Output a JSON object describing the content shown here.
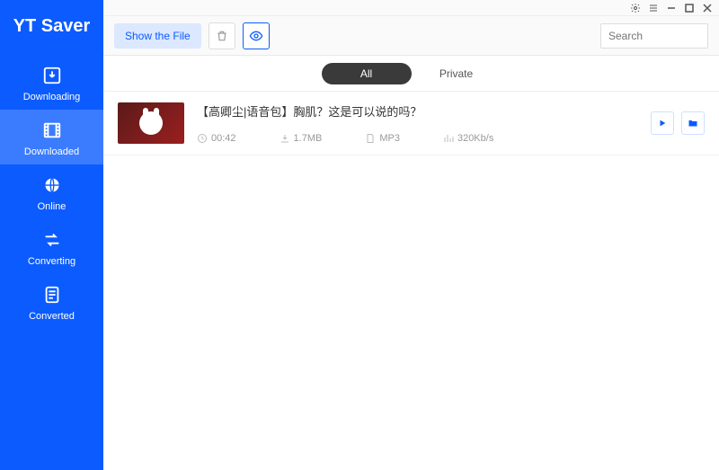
{
  "app": {
    "title": "YT Saver"
  },
  "sidebar": {
    "items": [
      {
        "label": "Downloading"
      },
      {
        "label": "Downloaded"
      },
      {
        "label": "Online"
      },
      {
        "label": "Converting"
      },
      {
        "label": "Converted"
      }
    ],
    "activeIndex": 1
  },
  "toolbar": {
    "show_file_label": "Show the File",
    "search_placeholder": "Search"
  },
  "tabs": {
    "items": [
      "All",
      "Private"
    ],
    "activeIndex": 0
  },
  "rows": [
    {
      "title": "【高卿尘|语音包】胸肌？这是可以说的吗？",
      "duration": "00:42",
      "size": "1.7MB",
      "format": "MP3",
      "bitrate": "320Kb/s"
    }
  ]
}
